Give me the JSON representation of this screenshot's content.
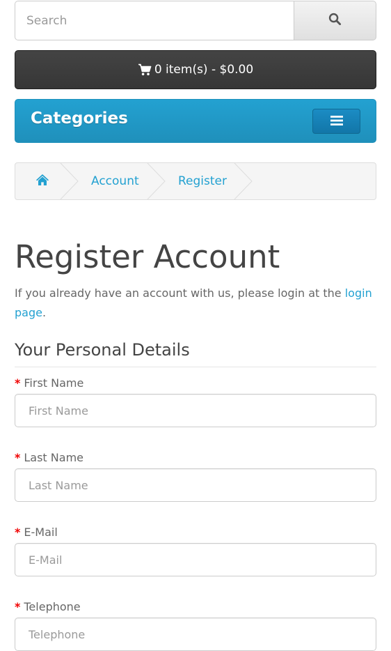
{
  "search": {
    "placeholder": "Search",
    "button_icon": "search-icon"
  },
  "cart": {
    "icon": "shopping-cart-icon",
    "label": "0 item(s) - $0.00"
  },
  "menu": {
    "title": "Categories",
    "toggle_icon": "hamburger-icon"
  },
  "breadcrumb": {
    "home_icon": "home-icon",
    "items": [
      {
        "label": "Account"
      },
      {
        "label": "Register"
      }
    ]
  },
  "page": {
    "title": "Register Account",
    "intro_text": "If you already have an account with us, please login at the ",
    "intro_link": "login page",
    "intro_end": "."
  },
  "section": {
    "title": "Your Personal Details"
  },
  "form": {
    "required_marker": "*",
    "fields": [
      {
        "label": "First Name",
        "placeholder": "First Name"
      },
      {
        "label": "Last Name",
        "placeholder": "Last Name"
      },
      {
        "label": "E-Mail",
        "placeholder": "E-Mail"
      },
      {
        "label": "Telephone",
        "placeholder": "Telephone"
      }
    ]
  },
  "colors": {
    "accent": "#23a1d1",
    "cart_bg": "#3d3d3d",
    "required": "#f00000",
    "title_text": "#444444"
  }
}
